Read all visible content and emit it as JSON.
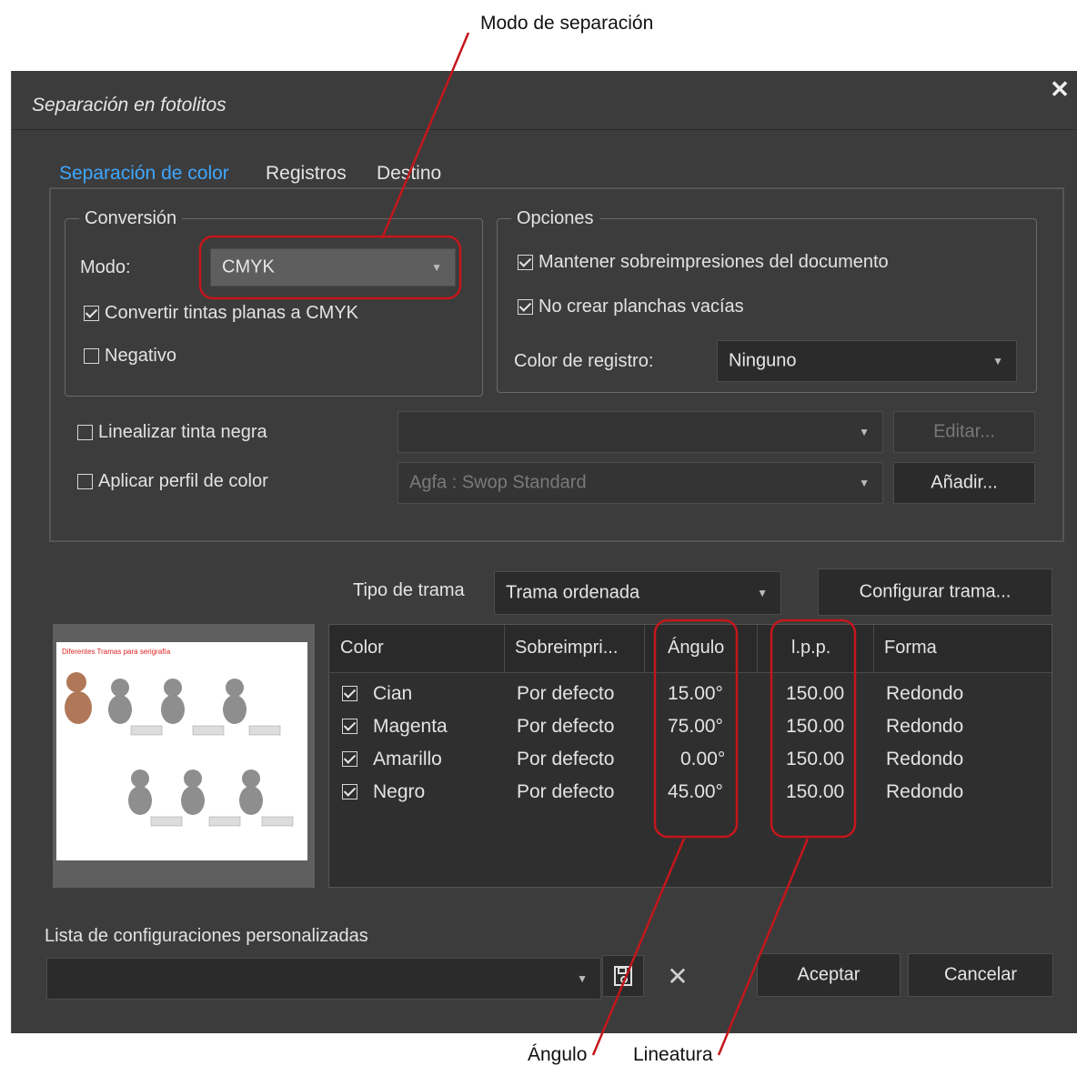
{
  "annotations": {
    "top": "Modo de separación",
    "bottom_left": "Ángulo",
    "bottom_right": "Lineatura"
  },
  "dialog": {
    "title": "Separación en fotolitos",
    "close_glyph": "✕"
  },
  "tabs": [
    {
      "label": "Separación de color",
      "active": true
    },
    {
      "label": "Registros",
      "active": false
    },
    {
      "label": "Destino",
      "active": false
    }
  ],
  "conversion": {
    "legend": "Conversión",
    "mode_label": "Modo:",
    "mode_value": "CMYK",
    "convert_spot": {
      "label": "Convertir tintas planas a CMYK",
      "checked": true
    },
    "negative": {
      "label": "Negativo",
      "checked": false
    }
  },
  "options": {
    "legend": "Opciones",
    "keep_overprints": {
      "label": "Mantener sobreimpresiones del documento",
      "checked": true
    },
    "no_empty_plates": {
      "label": "No crear planchas vacías",
      "checked": true
    },
    "registration_label": "Color de registro:",
    "registration_value": "Ninguno"
  },
  "linearize": {
    "label": "Linealizar tinta negra",
    "checked": false,
    "value": "",
    "button": "Editar..."
  },
  "color_profile": {
    "label": "Aplicar perfil de color",
    "checked": false,
    "value": "Agfa : Swop Standard",
    "button": "Añadir..."
  },
  "screen": {
    "label": "Tipo de trama",
    "value": "Trama ordenada",
    "button": "Configurar trama..."
  },
  "preview": {
    "caption": "Diferentes Tramas para serigrafía"
  },
  "table": {
    "columns": [
      "Color",
      "Sobreimpri...",
      "Ángulo",
      "l.p.p.",
      "Forma"
    ],
    "rows": [
      {
        "checked": true,
        "color": "Cian",
        "overprint": "Por defecto",
        "angle": "15.00°",
        "lpi": "150.00",
        "shape": "Redondo"
      },
      {
        "checked": true,
        "color": "Magenta",
        "overprint": "Por defecto",
        "angle": "75.00°",
        "lpi": "150.00",
        "shape": "Redondo"
      },
      {
        "checked": true,
        "color": "Amarillo",
        "overprint": "Por defecto",
        "angle": "0.00°",
        "lpi": "150.00",
        "shape": "Redondo"
      },
      {
        "checked": true,
        "color": "Negro",
        "overprint": "Por defecto",
        "angle": "45.00°",
        "lpi": "150.00",
        "shape": "Redondo"
      }
    ]
  },
  "presets": {
    "label": "Lista de configuraciones personalizadas",
    "value": "",
    "ok": "Aceptar",
    "cancel": "Cancelar"
  },
  "colors": {
    "dialog_bg": "#3c3c3c",
    "accent_tab": "#3ea7ff",
    "callout_red": "#c4161c"
  }
}
